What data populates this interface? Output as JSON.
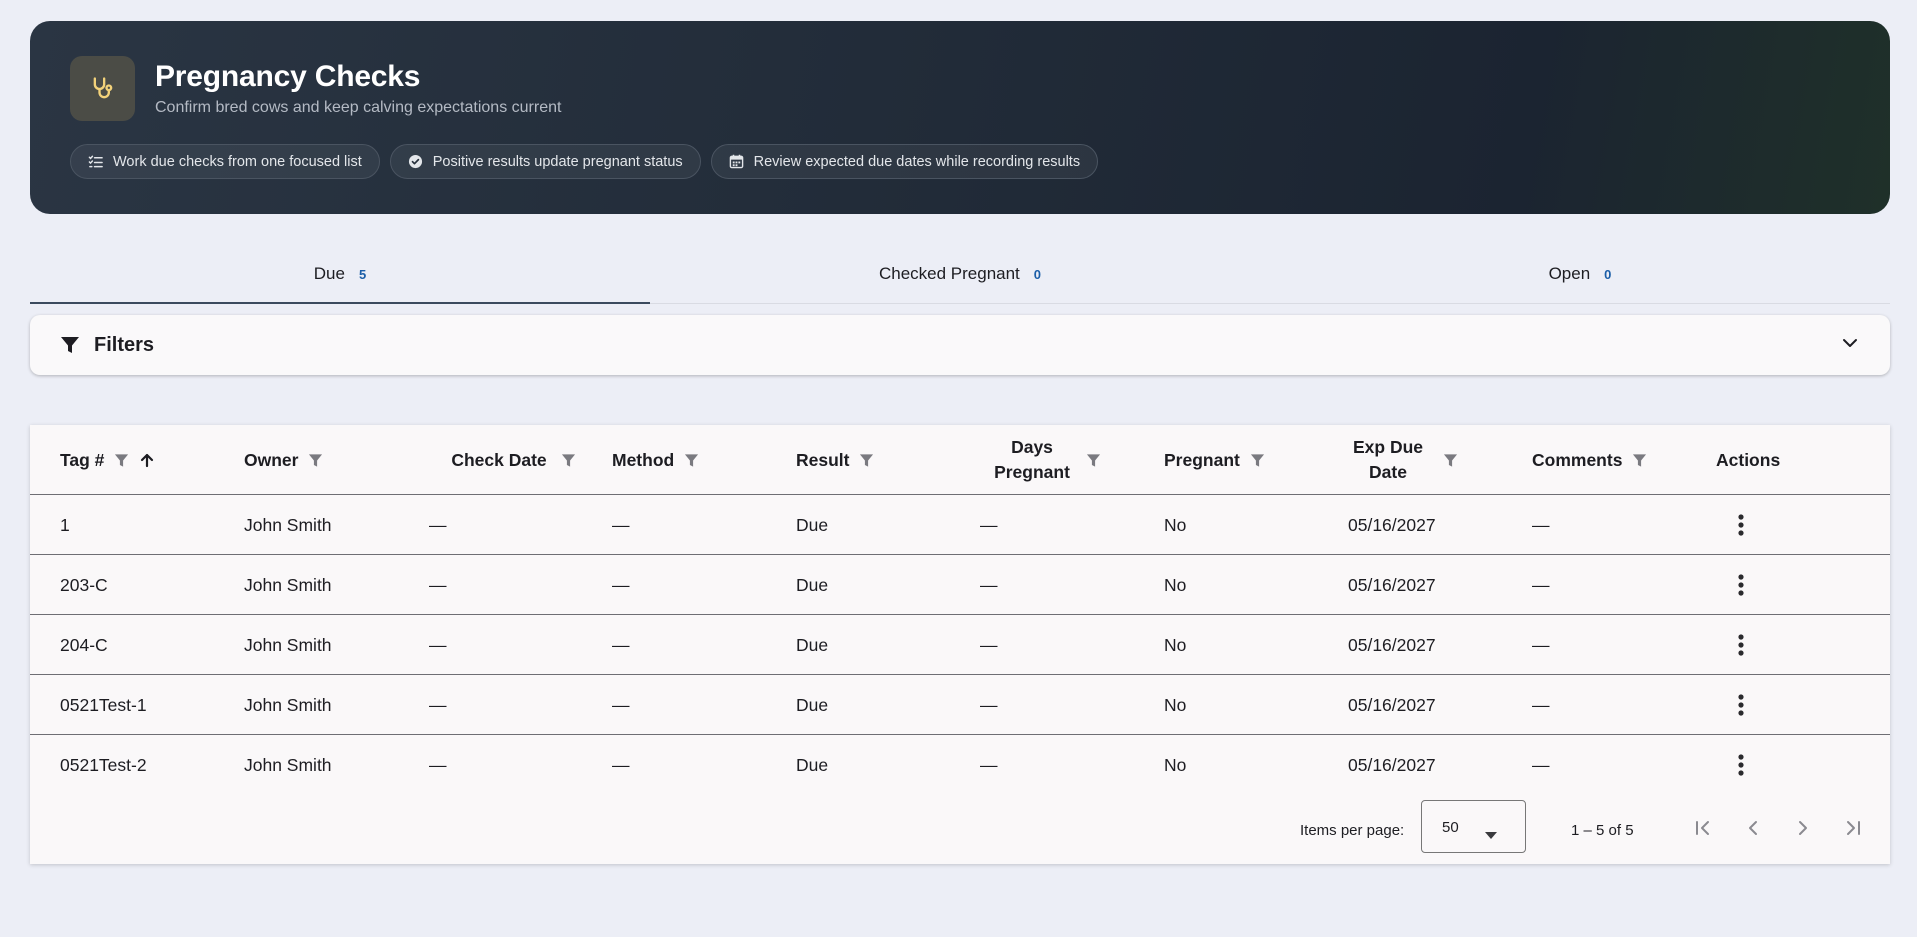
{
  "hero": {
    "title": "Pregnancy Checks",
    "subtitle": "Confirm bred cows and keep calving expectations current",
    "icon": "stethoscope-icon",
    "chips": [
      {
        "icon": "checklist-icon",
        "label": "Work due checks from one focused list"
      },
      {
        "icon": "check-circle-icon",
        "label": "Positive results update pregnant status"
      },
      {
        "icon": "calendar-icon",
        "label": "Review expected due dates while recording results"
      }
    ]
  },
  "tabs": [
    {
      "label": "Due",
      "count": "5",
      "active": true
    },
    {
      "label": "Checked Pregnant",
      "count": "0",
      "active": false
    },
    {
      "label": "Open",
      "count": "0",
      "active": false
    }
  ],
  "filters": {
    "label": "Filters"
  },
  "table": {
    "columns": [
      {
        "label": "Tag #",
        "filter": true,
        "sort": "asc"
      },
      {
        "label": "Owner",
        "filter": true
      },
      {
        "label": "Check Date",
        "filter": true
      },
      {
        "label": "Method",
        "filter": true
      },
      {
        "label": "Result",
        "filter": true
      },
      {
        "label": "Days Pregnant",
        "filter": true
      },
      {
        "label": "Pregnant",
        "filter": true
      },
      {
        "label": "Exp Due Date",
        "filter": true
      },
      {
        "label": "Comments",
        "filter": true
      },
      {
        "label": "Actions",
        "filter": false
      }
    ],
    "rows": [
      [
        "1",
        "John Smith",
        "—",
        "—",
        "Due",
        "—",
        "No",
        "05/16/2027",
        "—"
      ],
      [
        "203-C",
        "John Smith",
        "—",
        "—",
        "Due",
        "—",
        "No",
        "05/16/2027",
        "—"
      ],
      [
        "204-C",
        "John Smith",
        "—",
        "—",
        "Due",
        "—",
        "No",
        "05/16/2027",
        "—"
      ],
      [
        "0521Test-1",
        "John Smith",
        "—",
        "—",
        "Due",
        "—",
        "No",
        "05/16/2027",
        "—"
      ],
      [
        "0521Test-2",
        "John Smith",
        "—",
        "—",
        "Due",
        "—",
        "No",
        "05/16/2027",
        "—"
      ]
    ]
  },
  "paginator": {
    "items_per_page_label": "Items per page:",
    "page_size": "50",
    "range": "1 – 5 of 5"
  },
  "colors": {
    "accent": "#1b5ea8",
    "hero_icon": "#f3d27a",
    "tab_underline": "#3b4a5e"
  }
}
